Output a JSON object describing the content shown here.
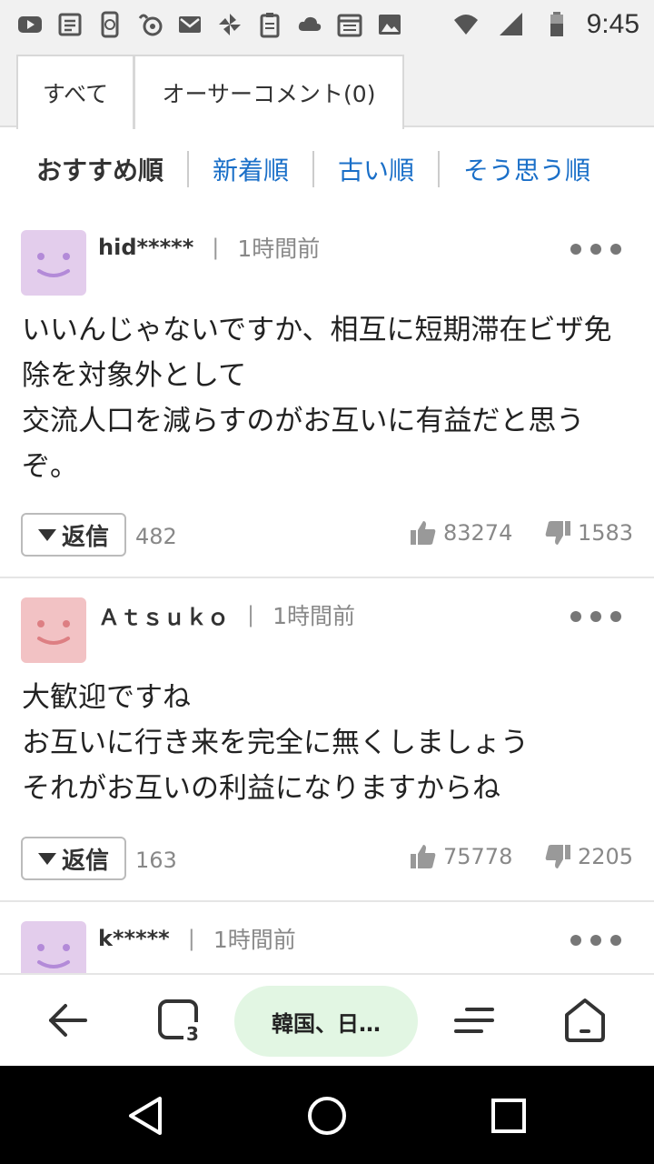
{
  "status_bar": {
    "time": "9:45",
    "left_icons": [
      "youtube-icon",
      "news-icon",
      "phone-sync-icon",
      "squirrel-icon",
      "gmail-icon",
      "pinwheel-icon",
      "clipboard-icon",
      "cloud-icon",
      "calendar-icon",
      "image-icon"
    ],
    "right_icons": [
      "wifi-icon",
      "signal-icon",
      "battery-icon"
    ]
  },
  "tabs": [
    {
      "label": "すべて",
      "active": true
    },
    {
      "label": "オーサーコメント(0)",
      "active": false
    }
  ],
  "sort_options": [
    {
      "label": "おすすめ順",
      "active": true
    },
    {
      "label": "新着順",
      "active": false
    },
    {
      "label": "古い順",
      "active": false
    },
    {
      "label": "そう思う順",
      "active": false
    }
  ],
  "comments": [
    {
      "user": "hid*****",
      "time": "1時間前",
      "avatar_color": "#e3cdec",
      "face_color": "#b38ad8",
      "body": "いいんじゃないですか、相互に短期滞在ビザ免除を対象外として\n交流人口を減らすのがお互いに有益だと思うぞ。",
      "reply_label": "返信",
      "reply_count": "482",
      "likes": "83274",
      "dislikes": "1583"
    },
    {
      "user": "Ａｔｓｕｋｏ",
      "time": "1時間前",
      "avatar_color": "#f2c2c4",
      "face_color": "#dd7f83",
      "body": "大歓迎ですね\nお互いに行き来を完全に無くしましょう\nそれがお互いの利益になりますからね",
      "reply_label": "返信",
      "reply_count": "163",
      "likes": "75778",
      "dislikes": "2205"
    },
    {
      "user": "k*****",
      "time": "1時間前",
      "avatar_color": "#e3cdec",
      "face_color": "#b38ad8"
    }
  ],
  "bottom_nav": {
    "tab_count": "3",
    "current_page": "韓国、日…"
  }
}
